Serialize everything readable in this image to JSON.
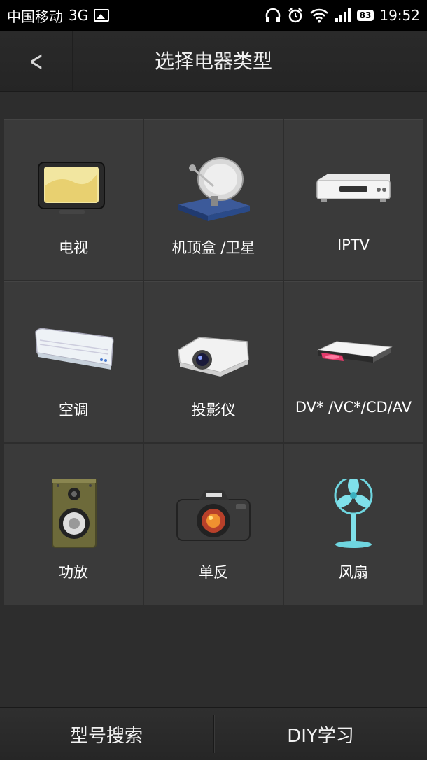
{
  "status_bar": {
    "carrier": "中国移动",
    "network": "3G",
    "battery": "83",
    "time": "19:52",
    "icons": [
      "image-icon",
      "headphones-icon",
      "alarm-icon",
      "wifi-icon",
      "signal-icon",
      "battery-icon"
    ]
  },
  "header": {
    "back_icon": "chevron-left-icon",
    "title": "选择电器类型"
  },
  "devices": [
    {
      "label": "电视",
      "icon": "tv-icon"
    },
    {
      "label": "机顶盒 /卫星",
      "icon": "satellite-dish-icon"
    },
    {
      "label": "IPTV",
      "icon": "iptv-box-icon"
    },
    {
      "label": "空调",
      "icon": "air-conditioner-icon"
    },
    {
      "label": "投影仪",
      "icon": "projector-icon"
    },
    {
      "label": "DV* /VC*/CD/AV",
      "icon": "dvd-player-icon"
    },
    {
      "label": "功放",
      "icon": "speaker-icon"
    },
    {
      "label": "单反",
      "icon": "dslr-camera-icon"
    },
    {
      "label": "风扇",
      "icon": "fan-icon"
    }
  ],
  "bottom_bar": {
    "model_search_label": "型号搜索",
    "diy_learn_label": "DIY学习"
  }
}
